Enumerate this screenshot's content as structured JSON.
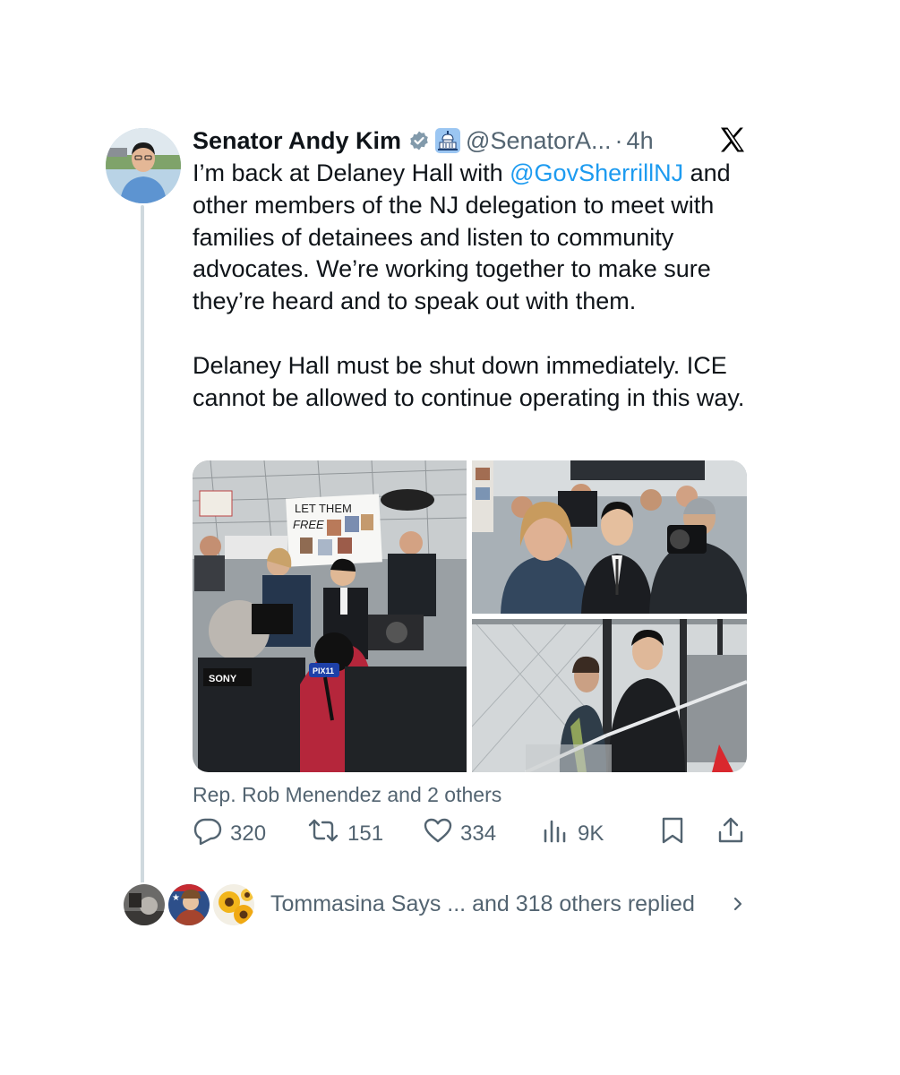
{
  "author": {
    "name": "Senator Andy Kim",
    "handle": "@SenatorA...",
    "separator": "·",
    "time": "4h"
  },
  "icons": {
    "verified": "verified-badge-icon",
    "government": "capitol-government-icon",
    "platform": "x-logo-icon"
  },
  "tweet": {
    "line1_before": "I’m back at Delaney Hall with ",
    "mention": "@GovSherrillNJ",
    "line1_after": " and other members of the NJ delegation to meet with families of detainees and listen to community advocates. We’re working together to make sure they’re heard and to speak out with them.",
    "paragraph2": "Delaney Hall must be shut down immediately. ICE cannot be allowed to continue operating in this way."
  },
  "media": {
    "sign_text_1": "LET THEM",
    "sign_text_2": "FREE",
    "camera_brand": "SONY",
    "mic_flag": "PIX11"
  },
  "tagged": "Rep. Rob Menendez and 2 others",
  "actions": {
    "replies": "320",
    "reposts": "151",
    "likes": "334",
    "views": "9K"
  },
  "replied_summary": "Tommasina Says ... and 318 others replied",
  "colors": {
    "link": "#1d9bf0",
    "muted": "#536471",
    "thread_line": "#cfd9de"
  }
}
